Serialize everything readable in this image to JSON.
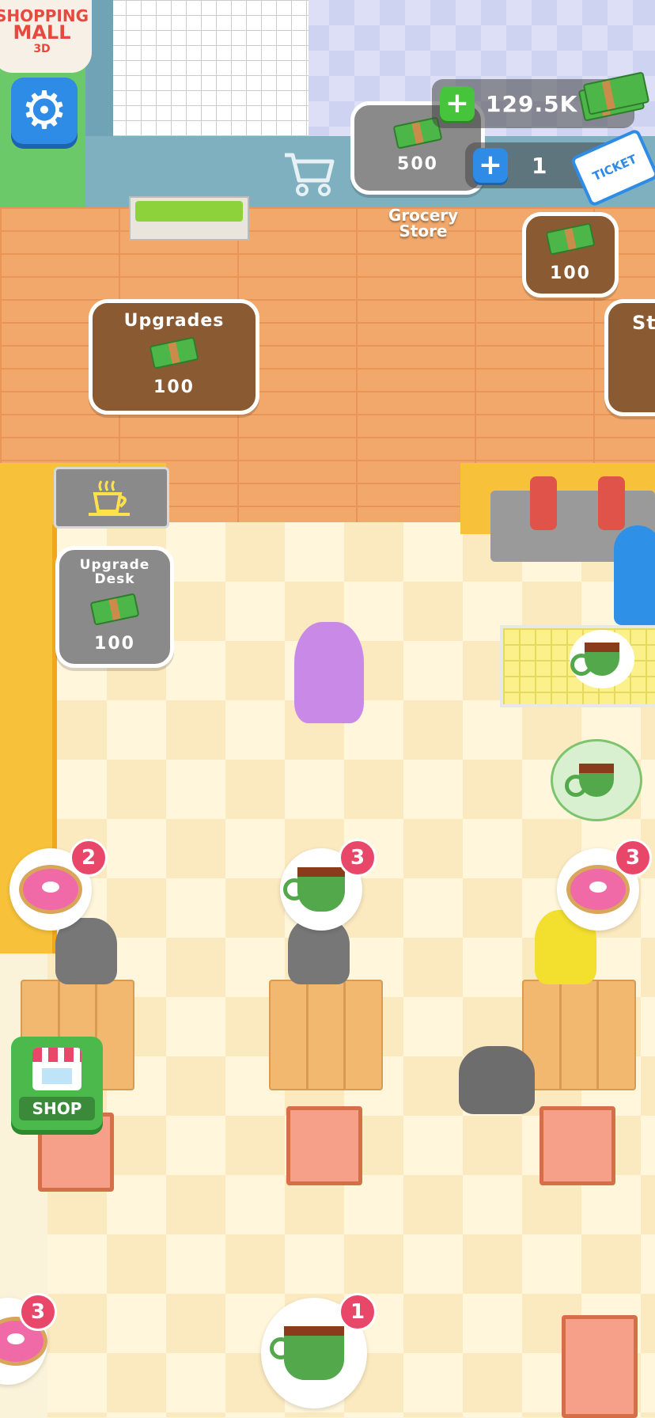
{
  "game": {
    "title_line1": "SHOPPING",
    "title_line2": "MALL",
    "title_line3": "3D"
  },
  "hud": {
    "cash_amount": "129.5K",
    "ticket_count": "1",
    "ticket_label": "TICKET",
    "plus_symbol": "+"
  },
  "store_pads": {
    "grocery_cost": "500",
    "grocery_label_line1": "Grocery",
    "grocery_label_line2": "Store",
    "right_pad_cost": "100",
    "partial_pad_label": "St",
    "upgrades_label": "Upgrades",
    "upgrades_cost": "100",
    "upgrade_desk_label_line1": "Upgrade",
    "upgrade_desk_label_line2": "Desk",
    "upgrade_desk_cost": "100"
  },
  "shop_button": {
    "label": "SHOP"
  },
  "orders": [
    {
      "item": "donut",
      "count": "2"
    },
    {
      "item": "coffee",
      "count": "3"
    },
    {
      "item": "donut",
      "count": "3"
    },
    {
      "item": "donut",
      "count": "3"
    },
    {
      "item": "coffee",
      "count": "1"
    }
  ],
  "icons": {
    "settings": "gear-icon",
    "cart": "cart-icon",
    "coffee_sign": "coffee-cup-icon"
  }
}
